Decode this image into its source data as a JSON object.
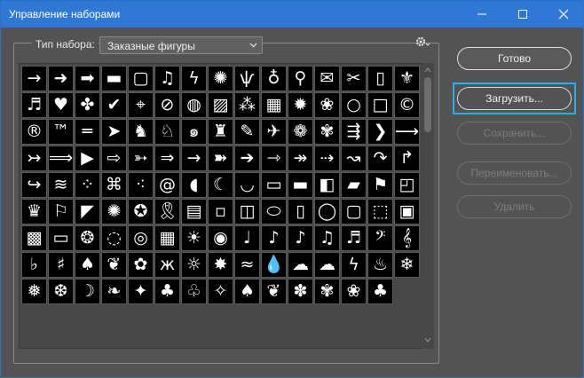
{
  "window": {
    "title": "Управление наборами"
  },
  "preset": {
    "label": "Тип набора:",
    "value": "Заказные фигуры"
  },
  "buttons": {
    "done": "Готово",
    "load": "Загрузить...",
    "save": "Сохранить...",
    "rename": "Переименовать...",
    "delete": "Удалить"
  },
  "colors": {
    "titlebar": "#2f78d6",
    "focus": "#2ab0e8",
    "panel": "#535353"
  },
  "shapes": [
    {
      "name": "arrow-thin-icon",
      "glyph": "→"
    },
    {
      "name": "arrow-bold-icon",
      "glyph": "➜"
    },
    {
      "name": "arrow-block-icon",
      "glyph": "➡"
    },
    {
      "name": "banner-icon",
      "glyph": "▬"
    },
    {
      "name": "frame-square-icon",
      "glyph": "▢"
    },
    {
      "name": "music-notes-icon",
      "glyph": "♫"
    },
    {
      "name": "lightning-icon",
      "glyph": "ϟ"
    },
    {
      "name": "starburst-icon",
      "glyph": "✺"
    },
    {
      "name": "grass-icon",
      "glyph": "ѱ"
    },
    {
      "name": "lightbulb-icon",
      "glyph": "♁"
    },
    {
      "name": "pushpin-icon",
      "glyph": "⚲"
    },
    {
      "name": "envelope-icon",
      "glyph": "✉"
    },
    {
      "name": "scissors-icon",
      "glyph": "✂"
    },
    {
      "name": "frame-rect-icon",
      "glyph": "▯"
    },
    {
      "name": "fleur-de-lis-icon",
      "glyph": "⚜"
    },
    {
      "name": "snail-music-icon",
      "glyph": "♬"
    },
    {
      "name": "heart-icon",
      "glyph": "♥"
    },
    {
      "name": "puzzle-icon",
      "glyph": "✤"
    },
    {
      "name": "checkmark-icon",
      "glyph": "✔"
    },
    {
      "name": "target-icon",
      "glyph": "⌖"
    },
    {
      "name": "no-sign-icon",
      "glyph": "⊘"
    },
    {
      "name": "speech-bubble-icon",
      "glyph": "◍"
    },
    {
      "name": "hatch-square-icon",
      "glyph": "▨"
    },
    {
      "name": "checker-icon",
      "glyph": "⁂"
    },
    {
      "name": "grid-icon",
      "glyph": "▦"
    },
    {
      "name": "burst-icon",
      "glyph": "✹"
    },
    {
      "name": "paw-icon",
      "glyph": "❀"
    },
    {
      "name": "circle-icon",
      "glyph": "○"
    },
    {
      "name": "square-icon",
      "glyph": "□"
    },
    {
      "name": "copyright-icon",
      "glyph": "©"
    },
    {
      "name": "registered-icon",
      "glyph": "®"
    },
    {
      "name": "trademark-icon",
      "glyph": "™"
    },
    {
      "name": "bone-icon",
      "glyph": "═"
    },
    {
      "name": "fish-icon",
      "glyph": "➤"
    },
    {
      "name": "cat-icon",
      "glyph": "♞"
    },
    {
      "name": "dog-icon",
      "glyph": "♘"
    },
    {
      "name": "snail-icon",
      "glyph": "๑"
    },
    {
      "name": "rabbit-icon",
      "glyph": "♜"
    },
    {
      "name": "feather-icon",
      "glyph": "✎"
    },
    {
      "name": "bird-icon",
      "glyph": "✈"
    },
    {
      "name": "paw-print-icon",
      "glyph": "❁"
    },
    {
      "name": "paw-print2-icon",
      "glyph": "✾"
    },
    {
      "name": "arrow-feather-icon",
      "glyph": "⇶"
    },
    {
      "name": "chevron-icon",
      "glyph": "❯"
    },
    {
      "name": "arrow-line-icon",
      "glyph": "⟶"
    },
    {
      "name": "arrow-tail-icon",
      "glyph": "↣"
    },
    {
      "name": "arrow-long-icon",
      "glyph": "⟹"
    },
    {
      "name": "triangle-right-icon",
      "glyph": "▶"
    },
    {
      "name": "arrow-heavy-icon",
      "glyph": "⇨"
    },
    {
      "name": "arrow-dart-icon",
      "glyph": "➳"
    },
    {
      "name": "arrow-fat-icon",
      "glyph": "⇒"
    },
    {
      "name": "arrow-right2-icon",
      "glyph": "→"
    },
    {
      "name": "arrow-notch-icon",
      "glyph": "➽"
    },
    {
      "name": "arrow-block2-icon",
      "glyph": "➔"
    },
    {
      "name": "arrow-cross-icon",
      "glyph": "⇾"
    },
    {
      "name": "arrow-feathered-icon",
      "glyph": "↠"
    },
    {
      "name": "arrow-dashed-icon",
      "glyph": "⇢"
    },
    {
      "name": "arrow-wave-icon",
      "glyph": "↝"
    },
    {
      "name": "u-turn-icon",
      "glyph": "↷"
    },
    {
      "name": "turn-up-icon",
      "glyph": "↱"
    },
    {
      "name": "turn-right-icon",
      "glyph": "↪"
    },
    {
      "name": "texture-icon",
      "glyph": "≋"
    },
    {
      "name": "splatter-icon",
      "glyph": "⁘"
    },
    {
      "name": "leaf-net-icon",
      "glyph": "⌘"
    },
    {
      "name": "sparkles-icon",
      "glyph": "⁖"
    },
    {
      "name": "swirl-icon",
      "glyph": "@"
    },
    {
      "name": "wave-banner-icon",
      "glyph": "◖"
    },
    {
      "name": "blade-icon",
      "glyph": "☾"
    },
    {
      "name": "curve-icon",
      "glyph": "◡"
    },
    {
      "name": "scroll-banner-icon",
      "glyph": "▭"
    },
    {
      "name": "ribbon-banner-icon",
      "glyph": "▬"
    },
    {
      "name": "tag-icon",
      "glyph": "◧"
    },
    {
      "name": "flag-banner-icon",
      "glyph": "▰"
    },
    {
      "name": "wave-flag-icon",
      "glyph": "⚑"
    },
    {
      "name": "sign-icon",
      "glyph": "◰"
    },
    {
      "name": "trophy-icon",
      "glyph": "♛"
    },
    {
      "name": "pennant-icon",
      "glyph": "⚐"
    },
    {
      "name": "flag-wave-icon",
      "glyph": "◤"
    },
    {
      "name": "seal-icon",
      "glyph": "✺"
    },
    {
      "name": "award-icon",
      "glyph": "✪"
    },
    {
      "name": "awareness-ribbon-icon",
      "glyph": "🎗"
    },
    {
      "name": "film-frame-icon",
      "glyph": "▤"
    },
    {
      "name": "dotted-frame-icon",
      "glyph": "▫"
    },
    {
      "name": "ornate-frame-icon",
      "glyph": "◫"
    },
    {
      "name": "oval-frame-icon",
      "glyph": "⬭"
    },
    {
      "name": "rect-frame-icon",
      "glyph": "▯"
    },
    {
      "name": "oval-frame2-icon",
      "glyph": "◯"
    },
    {
      "name": "frame-deco-icon",
      "glyph": "▢"
    },
    {
      "name": "frame-scallop-icon",
      "glyph": "⬚"
    },
    {
      "name": "frame-rough-icon",
      "glyph": "▣"
    },
    {
      "name": "frame-edge-icon",
      "glyph": "▩"
    },
    {
      "name": "frame-line-icon",
      "glyph": "▭"
    },
    {
      "name": "floral-circle-icon",
      "glyph": "❂"
    },
    {
      "name": "rough-circle-icon",
      "glyph": "◌"
    },
    {
      "name": "dots-circle-icon",
      "glyph": "◎"
    },
    {
      "name": "grunge-square-icon",
      "glyph": "▦"
    },
    {
      "name": "sun-burst-icon",
      "glyph": "☀"
    },
    {
      "name": "eye-icon",
      "glyph": "◉"
    },
    {
      "name": "quarter-note-icon",
      "glyph": "♩"
    },
    {
      "name": "eighth-note-icon",
      "glyph": "♪"
    },
    {
      "name": "note-head-icon",
      "glyph": "♪"
    },
    {
      "name": "sixteenth-note-icon",
      "glyph": "♫"
    },
    {
      "name": "beam-notes-icon",
      "glyph": "♬"
    },
    {
      "name": "bass-clef-icon",
      "glyph": "𝄢"
    },
    {
      "name": "treble-clef-icon",
      "glyph": "𝄞"
    },
    {
      "name": "flat-icon",
      "glyph": "♭"
    },
    {
      "name": "sharp-icon",
      "glyph": "♯"
    },
    {
      "name": "tree-icon",
      "glyph": "♠"
    },
    {
      "name": "fern-icon",
      "glyph": "❦"
    },
    {
      "name": "flower-icon",
      "glyph": "✿"
    },
    {
      "name": "butterfly-icon",
      "glyph": "ж"
    },
    {
      "name": "sun-icon",
      "glyph": "☼"
    },
    {
      "name": "spark-icon",
      "glyph": "✸"
    },
    {
      "name": "waves-icon",
      "glyph": "≈"
    },
    {
      "name": "drop-icon",
      "glyph": "💧"
    },
    {
      "name": "cloud-icon",
      "glyph": "☁"
    },
    {
      "name": "cloud-outline-icon",
      "glyph": "☁"
    },
    {
      "name": "bolt-icon",
      "glyph": "ϟ"
    },
    {
      "name": "flame-icon",
      "glyph": "♨"
    },
    {
      "name": "snowflake-icon",
      "glyph": "❄"
    },
    {
      "name": "snowflake2-icon",
      "glyph": "❅"
    },
    {
      "name": "snowflake3-icon",
      "glyph": "❆"
    },
    {
      "name": "moon-icon",
      "glyph": "☽"
    },
    {
      "name": "leaf-icon",
      "glyph": "❧"
    },
    {
      "name": "maple-leaf-icon",
      "glyph": "✦"
    },
    {
      "name": "leaf2-icon",
      "glyph": "♣"
    },
    {
      "name": "leaf3-icon",
      "glyph": "♧"
    },
    {
      "name": "maple2-icon",
      "glyph": "✧"
    },
    {
      "name": "leaf4-icon",
      "glyph": "♠"
    },
    {
      "name": "leaf5-icon",
      "glyph": "❦"
    },
    {
      "name": "flower2-icon",
      "glyph": "✽"
    },
    {
      "name": "flower3-icon",
      "glyph": "✾"
    },
    {
      "name": "flower4-icon",
      "glyph": "❀"
    },
    {
      "name": "clover-icon",
      "glyph": "♣"
    }
  ]
}
